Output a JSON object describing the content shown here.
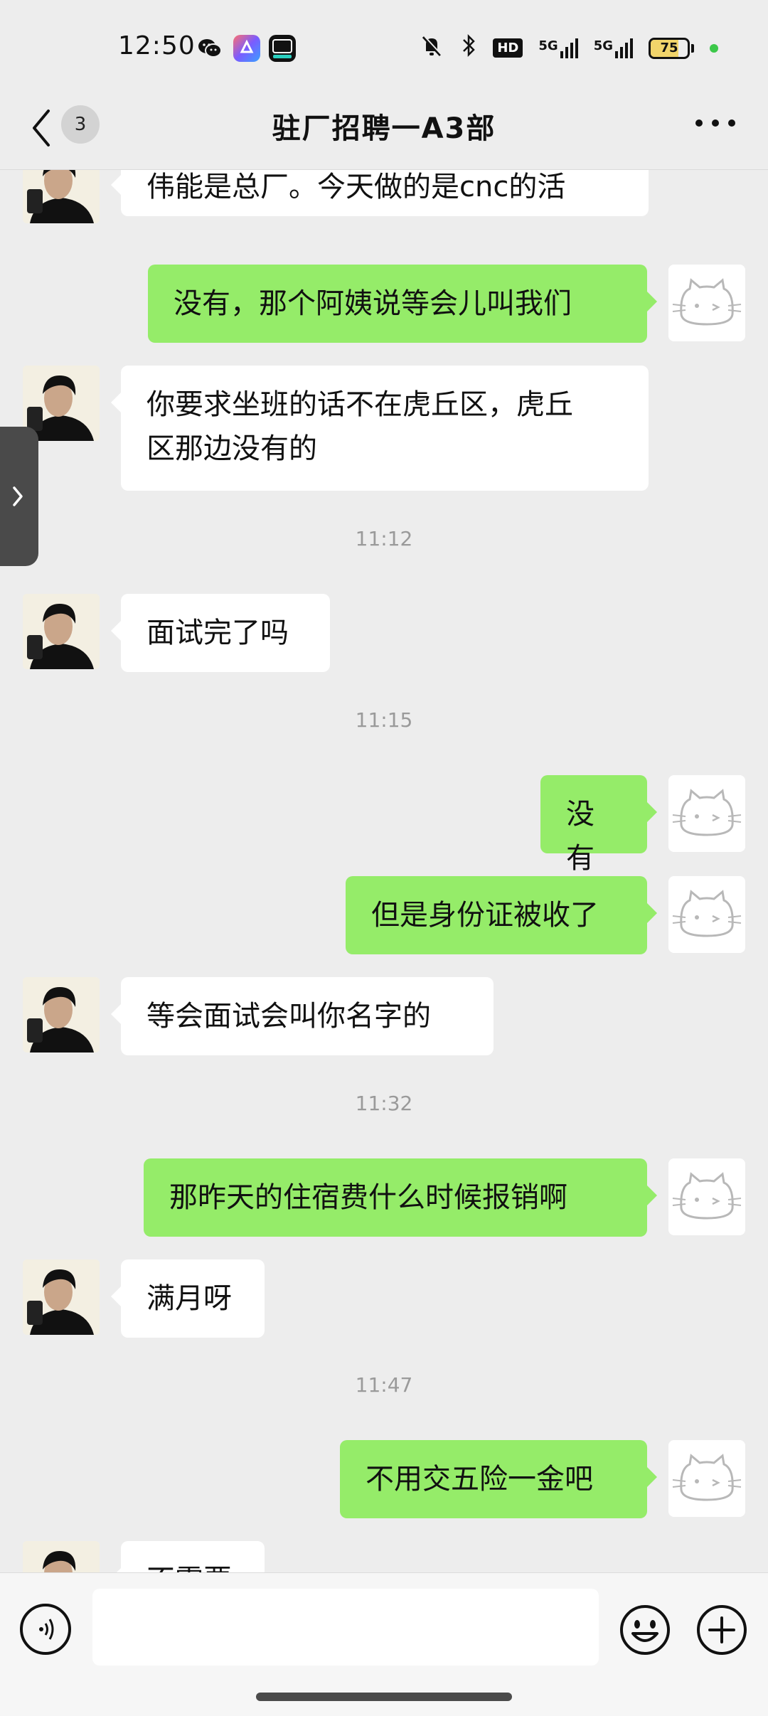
{
  "status_bar": {
    "time": "12:50",
    "network_1": "5G",
    "network_2": "5G",
    "hd_label": "HD",
    "battery_percent": 75,
    "battery_label": "75",
    "app_icons": [
      "wechat-icon",
      "app-store-icon",
      "dewu-app-icon"
    ]
  },
  "header": {
    "back_badge": "3",
    "title": "驻厂招聘一A3部"
  },
  "messages": [
    {
      "side": "in",
      "text": "伟能是总厂。今天做的是cnc的活"
    },
    {
      "side": "out",
      "text": "没有，那个阿姨说等会儿叫我们"
    },
    {
      "side": "in",
      "text": "你要求坐班的话不在虎丘区，虎丘\n区那边没有的"
    },
    {
      "type": "time",
      "text": "11:12"
    },
    {
      "side": "in",
      "text": "面试完了吗"
    },
    {
      "type": "time",
      "text": "11:15"
    },
    {
      "side": "out",
      "text": "没有"
    },
    {
      "side": "out",
      "text": "但是身份证被收了"
    },
    {
      "side": "in",
      "text": "等会面试会叫你名字的"
    },
    {
      "type": "time",
      "text": "11:32"
    },
    {
      "side": "out",
      "text": "那昨天的住宿费什么时候报销啊"
    },
    {
      "side": "in",
      "text": "满月呀"
    },
    {
      "type": "time",
      "text": "11:47"
    },
    {
      "side": "out",
      "text": "不用交五险一金吧"
    },
    {
      "side": "in",
      "text": "不需要"
    }
  ],
  "input": {
    "value": "",
    "placeholder": ""
  },
  "colors": {
    "background": "#ededed",
    "incoming_bubble": "#ffffff",
    "outgoing_bubble": "#95ec69",
    "timestamp": "#9a9a9a",
    "battery_fill": "#f1d46a",
    "status_dot": "#3cc84a"
  }
}
